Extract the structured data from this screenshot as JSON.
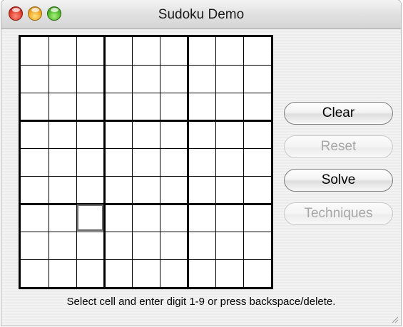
{
  "window": {
    "title": "Sudoku Demo"
  },
  "buttons": {
    "clear": "Clear",
    "reset": "Reset",
    "solve": "Solve",
    "techniques": "Techniques"
  },
  "status": {
    "message": "Select cell and enter digit 1-9 or press backspace/delete."
  },
  "board": {
    "selected_cell": {
      "row": 6,
      "col": 2
    },
    "cells": [
      [
        "",
        "",
        "",
        "",
        "",
        "",
        "",
        "",
        ""
      ],
      [
        "",
        "",
        "",
        "",
        "",
        "",
        "",
        "",
        ""
      ],
      [
        "",
        "",
        "",
        "",
        "",
        "",
        "",
        "",
        ""
      ],
      [
        "",
        "",
        "",
        "",
        "",
        "",
        "",
        "",
        ""
      ],
      [
        "",
        "",
        "",
        "",
        "",
        "",
        "",
        "",
        ""
      ],
      [
        "",
        "",
        "",
        "",
        "",
        "",
        "",
        "",
        ""
      ],
      [
        "",
        "",
        "",
        "",
        "",
        "",
        "",
        "",
        ""
      ],
      [
        "",
        "",
        "",
        "",
        "",
        "",
        "",
        "",
        ""
      ],
      [
        "",
        "",
        "",
        "",
        "",
        "",
        "",
        "",
        ""
      ]
    ]
  }
}
